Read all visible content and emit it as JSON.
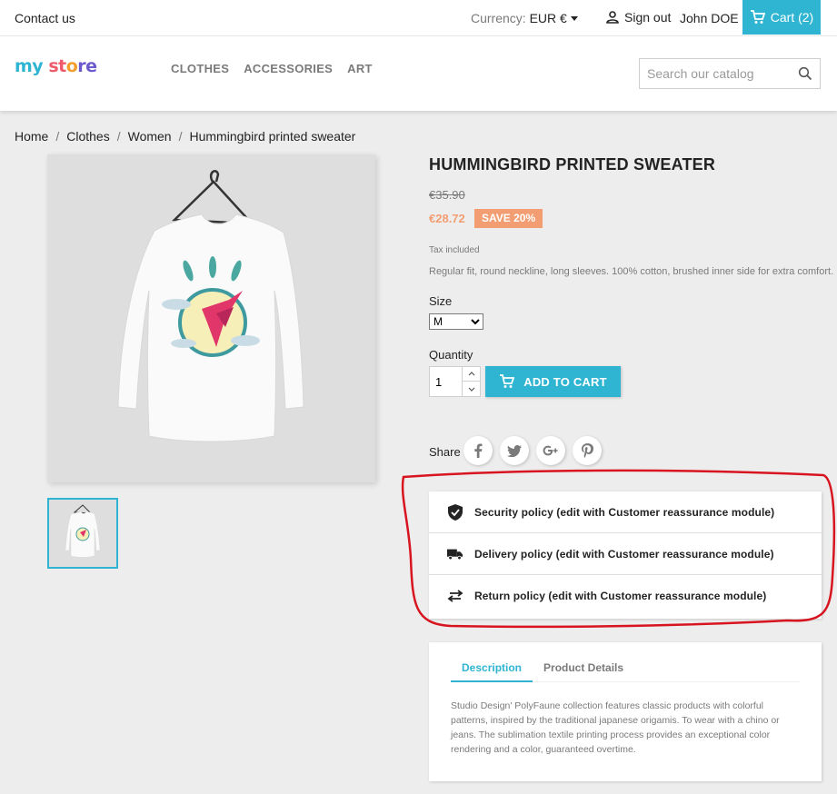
{
  "topbar": {
    "contact": "Contact us",
    "currency_label": "Currency:",
    "currency_value": "EUR €",
    "signout": "Sign out",
    "user": "John DOE",
    "cart": "Cart (2)"
  },
  "header": {
    "logo": {
      "part1": "my",
      "part2": "st",
      "part3": "o",
      "part4": "re"
    },
    "menu": [
      "CLOTHES",
      "ACCESSORIES",
      "ART"
    ],
    "search_placeholder": "Search our catalog"
  },
  "breadcrumb": [
    "Home",
    "Clothes",
    "Women",
    "Hummingbird printed sweater"
  ],
  "product": {
    "title": "HUMMINGBIRD PRINTED SWEATER",
    "old_price": "€35.90",
    "price": "€28.72",
    "discount": "SAVE 20%",
    "tax": "Tax included",
    "short_description": "Regular fit, round neckline, long sleeves. 100% cotton, brushed inner side for extra comfort.",
    "size_label": "Size",
    "size_value": "M",
    "quantity_label": "Quantity",
    "quantity_value": "1",
    "add_to_cart": "ADD TO CART",
    "share_label": "Share",
    "share_icons": [
      "facebook-icon",
      "twitter-icon",
      "google-plus-icon",
      "pinterest-icon"
    ]
  },
  "reassurance": [
    {
      "icon": "shield-check-icon",
      "label": "Security policy (edit with Customer reassurance module)"
    },
    {
      "icon": "truck-icon",
      "label": "Delivery policy (edit with Customer reassurance module)"
    },
    {
      "icon": "swap-arrows-icon",
      "label": "Return policy (edit with Customer reassurance module)"
    }
  ],
  "tabs": {
    "items": [
      "Description",
      "Product Details"
    ],
    "active": "Description",
    "description": "Studio Design' PolyFaune collection features classic products with colorful patterns, inspired by the traditional japanese origamis. To wear with a chino or jeans. The sublimation textile printing process provides an exceptional color rendering and a color, guaranteed overtime."
  },
  "colors": {
    "accent": "#2fb5d2",
    "discount": "#f39d72",
    "annotation": "#d7141f"
  }
}
